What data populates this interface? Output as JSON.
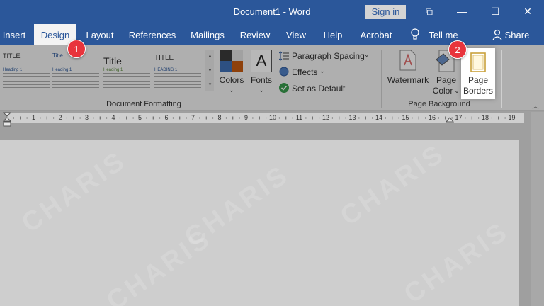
{
  "window": {
    "title": "Document1  -  Word",
    "sign_in": "Sign in",
    "controls": {
      "ribbon_display": "⧉",
      "minimize": "—",
      "maximize": "☐",
      "close": "✕"
    }
  },
  "tabs": [
    {
      "label": "Insert"
    },
    {
      "label": "Design"
    },
    {
      "label": "Layout"
    },
    {
      "label": "References"
    },
    {
      "label": "Mailings"
    },
    {
      "label": "Review"
    },
    {
      "label": "View"
    },
    {
      "label": "Help"
    },
    {
      "label": "Acrobat"
    }
  ],
  "tell_me": "Tell me",
  "share": "Share",
  "ribbon": {
    "style_gallery": [
      {
        "title": "TITLE",
        "heading": "Heading 1"
      },
      {
        "title": "Title",
        "heading": "Heading 1"
      },
      {
        "title": "Title",
        "heading": "Heading 1"
      },
      {
        "title": "TITLE",
        "heading": "HEADING 1"
      }
    ],
    "colors_label": "Colors",
    "fonts_label": "Fonts",
    "fonts_glyph": "A",
    "paragraph_spacing": "Paragraph Spacing",
    "effects": "Effects",
    "set_as_default": "Set as Default",
    "document_formatting_label": "Document Formatting",
    "watermark": "Watermark",
    "page_color": [
      "Page",
      "Color"
    ],
    "page_borders": [
      "Page",
      "Borders"
    ],
    "page_background_label": "Page Background"
  },
  "markers": [
    "1",
    "2"
  ],
  "ruler_numbers": [
    "1",
    "2",
    "3",
    "4",
    "5",
    "6",
    "7",
    "8",
    "9",
    "10",
    "11",
    "12",
    "13",
    "14",
    "15",
    "16",
    "17",
    "18",
    "19"
  ],
  "watermark_text": "CHARIS",
  "colors": {
    "accent": "#2b579a",
    "marker": "#e8343c"
  }
}
